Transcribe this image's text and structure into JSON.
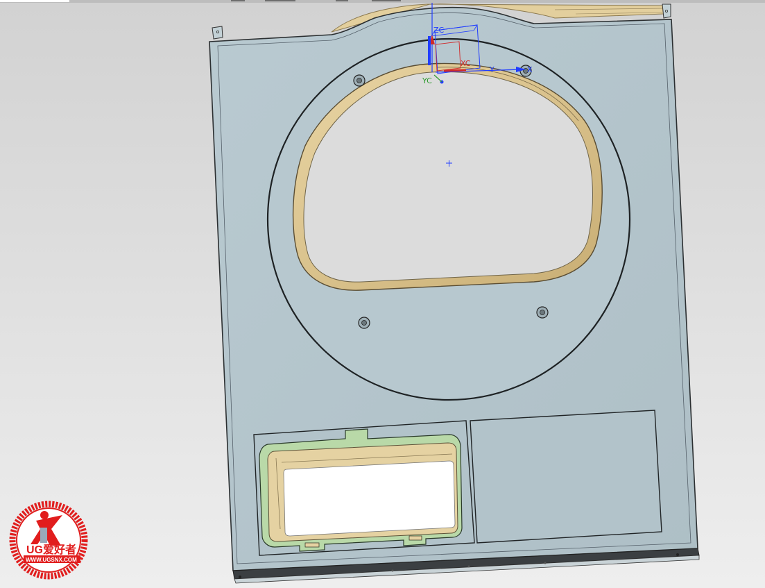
{
  "viewport": {
    "triad": {
      "zc_label": "ZC",
      "yc_label": "YC",
      "xc_label": "XC",
      "x_label": "X",
      "y_label": "Y"
    },
    "colors": {
      "panel_fill": "#b4c5cc",
      "panel_edge": "#2b2f31",
      "inner_hole": "#d9d9d9",
      "tan_rim": "#e2cc97",
      "green_flange": "#b8d8a8",
      "axis_blue": "#1f3cff",
      "axis_red": "#d02a2a",
      "axis_green": "#2e9a2e"
    }
  },
  "watermark": {
    "brand_text": "UG爱好者",
    "url_text": "WWW.UGSNX.COM",
    "ring_color": "#e11d1d"
  }
}
